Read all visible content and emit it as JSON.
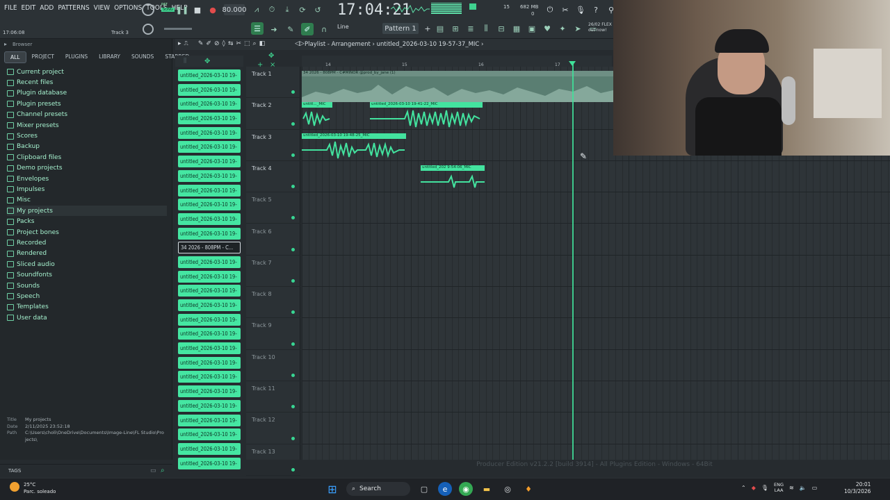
{
  "menu": [
    "FILE",
    "EDIT",
    "ADD",
    "PATTERNS",
    "VIEW",
    "OPTIONS",
    "TOOLS",
    "HELP"
  ],
  "transport": {
    "mode_pat": "PAT",
    "mode_song": "SONG",
    "tempo": "80.000",
    "time": "17:04:21",
    "song_position": "17:06:08",
    "hint_track": "Track 3",
    "cpu": "15",
    "memory": "682 MB",
    "mem_sub": "0"
  },
  "toolbar": {
    "snap": "Line",
    "pattern": "Pattern 1",
    "news_line1": "26/02 FLEX",
    "news_line2": "out now!"
  },
  "browser": {
    "title": "Browser",
    "tabs": [
      "ALL",
      "PROJECT",
      "PLUGINS",
      "LIBRARY",
      "SOUNDS",
      "STARRED"
    ],
    "folders": [
      "Current project",
      "Recent files",
      "Plugin database",
      "Plugin presets",
      "Channel presets",
      "Mixer presets",
      "Scores",
      "Backup",
      "Clipboard files",
      "Demo projects",
      "Envelopes",
      "Impulses",
      "Misc",
      "My projects",
      "Packs",
      "Project bones",
      "Recorded",
      "Rendered",
      "Sliced audio",
      "Soundfonts",
      "Sounds",
      "Speech",
      "Templates",
      "User data"
    ],
    "selected_folder": "My projects",
    "meta": {
      "title_k": "Title",
      "title_v": "My projects",
      "date_k": "Date",
      "date_v": "2/11/2025 23:52:18",
      "path_k": "Path",
      "path_v": "C:\\Users\\choli\\OneDrive\\Documents\\Image-Line\\FL Studio\\Projects\\"
    },
    "tags": "TAGS"
  },
  "clips": {
    "items": [
      "untitled_2026-03-10 19-",
      "untitled_2026-03-10 19-",
      "untitled_2026-03-10 19-",
      "untitled_2026-03-10 19-",
      "untitled_2026-03-10 19-",
      "untitled_2026-03-10 19-",
      "untitled_2026-03-10 19-",
      "untitled_2026-03-10 19-",
      "untitled_2026-03-10 19-",
      "untitled_2026-03-10 19-",
      "untitled_2026-03-10 19-",
      "untitled_2026-03-10 19-",
      "34 2026 - 808PM - C...",
      "untitled_2026-03-10 19-",
      "untitled_2026-03-10 19-",
      "untitled_2026-03-10 19-",
      "untitled_2026-03-10 19-",
      "untitled_2026-03-10 19-",
      "untitled_2026-03-10 19-",
      "untitled_2026-03-10 19-",
      "untitled_2026-03-10 19-",
      "untitled_2026-03-10 19-",
      "untitled_2026-03-10 19-",
      "untitled_2026-03-10 19-",
      "untitled_2026-03-10 19-",
      "untitled_2026-03-10 19-",
      "untitled_2026-03-10 19-",
      "untitled_2026-03-10 19-"
    ],
    "selected_index": 12
  },
  "playlist": {
    "title": "Playlist - Arrangement",
    "project": "untitled_2026-03-10 19-57-37_MIC",
    "ruler": [
      "14",
      "15",
      "16",
      "17"
    ],
    "tracks": [
      "Track 1",
      "Track 2",
      "Track 3",
      "Track 4",
      "Track 5",
      "Track 6",
      "Track 7",
      "Track 8",
      "Track 9",
      "Track 10",
      "Track 11",
      "Track 12",
      "Track 13"
    ],
    "master_clip": "34 2026 - 808PM - C#MINOR @prod_by_jane (1)",
    "t2_clip_a": "untitl..._MIC",
    "t2_clip_b": "untitled_2026-03-10 19-41-22_MIC",
    "t3_clip": "untitled_2026-03-10 19-48-25_MIC",
    "t4_clip": "untitled_202 9-54-06_MIC"
  },
  "status": "Producer Edition v21.2.2 [build 3914] - All Plugins Edition - Windows - 64Bit",
  "taskbar": {
    "temp": "25°C",
    "weather": "Parc. soleado",
    "search": "Search",
    "lang1": "ENG",
    "lang2": "LAA",
    "time": "20:01",
    "date": "10/3/2026"
  }
}
